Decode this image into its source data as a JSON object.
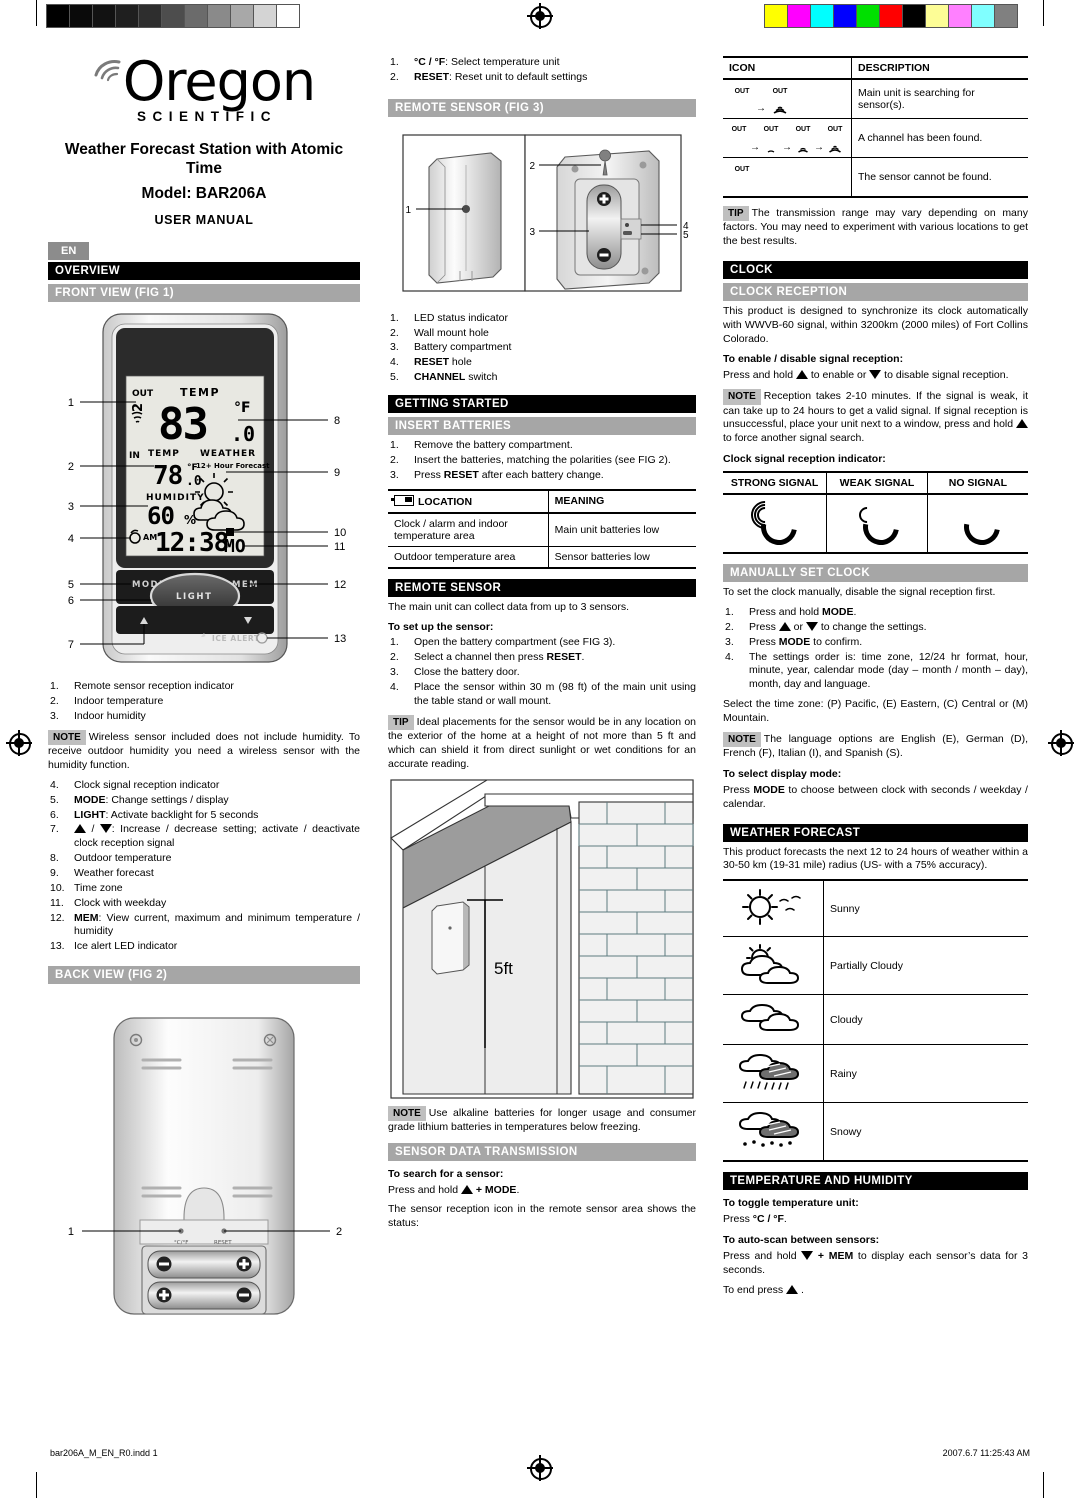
{
  "print_marks": {
    "grayscale_swatches": [
      "#000000",
      "#0a0a0a",
      "#121212",
      "#1f1f1f",
      "#2e2e2e",
      "#4d4d4d",
      "#6b6b6b",
      "#8a8a8a",
      "#a8a8a8",
      "#d4d4d4",
      "#ffffff"
    ],
    "color_swatches": [
      "#ffff00",
      "#ff00ff",
      "#00ffff",
      "#0000ff",
      "#00e000",
      "#ff0000",
      "#000000",
      "#fdfd96",
      "#ff80ff",
      "#80ffff",
      "#808080"
    ]
  },
  "title": {
    "brand": "Oregon",
    "brand_sub": "SCIENTIFIC",
    "product": "Weather Forecast Station with Atomic Time",
    "model": "Model: BAR206A",
    "doc_type": "USER MANUAL",
    "language_tab": "EN"
  },
  "left_column": {
    "overview_heading": "OVERVIEW",
    "front_view_heading": "FRONT VIEW (FIG 1)",
    "front_view_callouts_left": [
      "1",
      "2",
      "3",
      "4",
      "5",
      "6",
      "7"
    ],
    "front_view_callouts_right": [
      "8",
      "9",
      "10",
      "11",
      "12",
      "13"
    ],
    "lcd": {
      "out_label": "OUT",
      "channel": "2",
      "temp_label": "TEMP",
      "outdoor_temp": "83",
      "outdoor_unit": "°F",
      "outdoor_decimal": ".0",
      "in_label": "IN",
      "in_temp_label": "TEMP",
      "indoor_temp": "78",
      "indoor_unit": "°F",
      "indoor_decimal": ".0",
      "humidity_label": "HUMIDITY",
      "humidity": "60",
      "humidity_unit": "%",
      "weather_label": "WEATHER",
      "forecast_label": "12+ Hour Forecast",
      "am_label": "AM",
      "clock": "12:38",
      "weekday": "MO"
    },
    "buttons": {
      "mode": "MODE",
      "light": "LIGHT",
      "mem": "MEM",
      "ice_alert": "ICE ALERT"
    },
    "front_items": [
      {
        "n": "1.",
        "text": "Remote sensor reception indicator"
      },
      {
        "n": "2.",
        "text": "Indoor temperature"
      },
      {
        "n": "3.",
        "text": "Indoor humidity"
      }
    ],
    "note_humidity": {
      "tag": "NOTE",
      "text": "Wireless sensor included does not include humidity. To receive outdoor humidity you need a wireless sensor with the humidity function."
    },
    "front_items2": [
      {
        "n": "4.",
        "text": "Clock signal reception indicator"
      },
      {
        "n": "5.",
        "bold": "MODE",
        "text": ": Change settings / display"
      },
      {
        "n": "6.",
        "bold": "LIGHT",
        "text": ": Activate backlight for 5 seconds"
      },
      {
        "n": "7.",
        "text": ": Increase / decrease setting; activate / deactivate clock reception signal",
        "icons": true
      },
      {
        "n": "8.",
        "text": "Outdoor temperature"
      },
      {
        "n": "9.",
        "text": "Weather forecast"
      },
      {
        "n": "10.",
        "text": "Time zone"
      },
      {
        "n": "11.",
        "text": "Clock with weekday"
      },
      {
        "n": "12.",
        "bold": "MEM",
        "text": ": View current, maximum and minimum temperature / humidity"
      },
      {
        "n": "13.",
        "text": "Ice alert LED indicator"
      }
    ],
    "back_view_heading": "BACK VIEW (FIG 2)",
    "back_view_callouts": [
      "1",
      "2"
    ],
    "back_labels": {
      "cf": "°C/°F",
      "reset": "RESET"
    }
  },
  "mid_column": {
    "back_items": [
      {
        "n": "1.",
        "bold": "°C / °F",
        "text": ": Select temperature unit"
      },
      {
        "n": "2.",
        "bold": "RESET",
        "text": ": Reset unit to default settings"
      }
    ],
    "remote_sensor_fig_heading": "REMOTE SENSOR (FIG 3)",
    "remote_fig_callouts": [
      "1",
      "2",
      "3",
      "4",
      "5"
    ],
    "remote_items": [
      {
        "n": "1.",
        "text": "LED status indicator"
      },
      {
        "n": "2.",
        "text": "Wall mount hole"
      },
      {
        "n": "3.",
        "text": "Battery compartment"
      },
      {
        "n": "4.",
        "bold": "RESET",
        "text": " hole"
      },
      {
        "n": "5.",
        "bold": "CHANNEL",
        "text": " switch"
      }
    ],
    "getting_started_heading": "GETTING STARTED",
    "insert_batteries_heading": "INSERT BATTERIES",
    "battery_items": [
      {
        "n": "1.",
        "text": "Remove the battery compartment."
      },
      {
        "n": "2.",
        "text": "Insert the batteries, matching the polarities (see FIG 2)."
      },
      {
        "n": "3.",
        "bold": "RESET",
        "pre": "Press ",
        "text": " after each battery change."
      }
    ],
    "battery_table": {
      "headers": [
        "LOCATION",
        "MEANING"
      ],
      "rows": [
        [
          "Clock / alarm and indoor temperature area",
          "Main unit batteries low"
        ],
        [
          "Outdoor temperature area",
          "Sensor batteries low"
        ]
      ]
    },
    "remote_sensor_heading": "REMOTE SENSOR",
    "remote_intro": "The main unit can collect data from up to 3 sensors.",
    "setup_subhead": "To set up the sensor:",
    "setup_items": [
      {
        "n": "1.",
        "text": "Open the battery compartment (see FIG 3)."
      },
      {
        "n": "2.",
        "pre": "Select a channel then press ",
        "bold": "RESET",
        "text": "."
      },
      {
        "n": "3.",
        "text": "Close the battery door."
      },
      {
        "n": "4.",
        "text": "Place the sensor within 30 m (98 ft) of the main unit using the table stand or wall mount."
      }
    ],
    "tip_placement": {
      "tag": "TIP",
      "text": "Ideal placements for the sensor would be in any location on the exterior of the home at a height of not more than 5 ft and which can shield it from direct sunlight or wet conditions for an accurate reading."
    },
    "house_fig_label": "5ft",
    "note_alkaline": {
      "tag": "NOTE",
      "text": "Use alkaline batteries for longer usage and consumer grade lithium batteries in temperatures below freezing."
    },
    "sensor_data_heading": "SENSOR DATA TRANSMISSION",
    "search_subhead": "To search for a sensor:",
    "search_text_pre": "Press and hold ",
    "search_text_post": " + MODE",
    "search_text_end": ".",
    "status_text": "The sensor reception icon in the remote sensor area shows the status:"
  },
  "right_column": {
    "icon_table": {
      "headers": [
        "ICON",
        "DESCRIPTION"
      ],
      "rows": [
        {
          "icon_type": "searching",
          "description": "Main unit is searching for sensor(s)."
        },
        {
          "icon_type": "found",
          "description": "A channel has been found."
        },
        {
          "icon_type": "notfound",
          "description": "The sensor cannot be found."
        }
      ],
      "out_label": "OUT"
    },
    "tip_range": {
      "tag": "TIP",
      "text": "The transmission range may vary depending on many factors. You may need to experiment with various locations to get the best results."
    },
    "clock_heading": "CLOCK",
    "clock_reception_heading": "CLOCK RECEPTION",
    "clock_reception_text": "This product is designed to synchronize its clock automatically with WWVB-60 signal, within 3200km (2000 miles) of Fort Collins Colorado.",
    "enable_subhead": "To enable / disable signal reception:",
    "enable_pre": "Press and hold ",
    "enable_mid": " to enable or ",
    "enable_post": " to disable signal reception.",
    "note_reception": {
      "tag": "NOTE",
      "pre": "Reception takes 2-10 minutes. If the signal is weak, it can take up to 24 hours to get a valid signal. If signal reception is unsuccessful, place your unit next to a window, press and hold ",
      "post": " to force another signal search."
    },
    "clock_indicator_subhead": "Clock signal reception indicator:",
    "signal_table": {
      "headers": [
        "STRONG SIGNAL",
        "WEAK SIGNAL",
        "NO SIGNAL"
      ]
    },
    "manual_clock_heading": "MANUALLY SET CLOCK",
    "manual_clock_intro": "To set the clock manually, disable the signal reception first.",
    "manual_items": [
      {
        "n": "1.",
        "pre": "Press and hold ",
        "bold": "MODE",
        "text": "."
      },
      {
        "n": "2.",
        "pre": "Press ",
        "text": " to change the settings.",
        "icons": "updown"
      },
      {
        "n": "3.",
        "pre": "Press ",
        "bold": "MODE",
        "text": " to confirm."
      },
      {
        "n": "4.",
        "text": "The settings order is: time zone, 12/24 hr format, hour, minute, year, calendar mode (day – month / month – day), month, day and language."
      }
    ],
    "timezone_text": "Select the time zone: (P) Pacific, (E) Eastern, (C) Central or (M) Mountain.",
    "note_language": {
      "tag": "NOTE",
      "text": "The language options are English (E), German (D), French (F), Italian (I), and Spanish (S)."
    },
    "display_mode_subhead": "To select display mode:",
    "display_mode_pre": "Press ",
    "display_mode_bold": "MODE",
    "display_mode_post": " to choose between clock with seconds / weekday / calendar.",
    "weather_heading": "WEATHER FORECAST",
    "weather_intro": "This product forecasts the next 12 to 24 hours of weather within a 30-50 km (19-31 mile) radius (US- with a 75% accuracy).",
    "weather_rows": [
      {
        "icon": "sunny-icon",
        "label": "Sunny"
      },
      {
        "icon": "partially-cloudy-icon",
        "label": "Partially Cloudy"
      },
      {
        "icon": "cloudy-icon",
        "label": "Cloudy"
      },
      {
        "icon": "rainy-icon",
        "label": "Rainy"
      },
      {
        "icon": "snowy-icon",
        "label": "Snowy"
      }
    ],
    "temp_hum_heading": "TEMPERATURE AND HUMIDITY",
    "toggle_subhead": "To toggle temperature unit:",
    "toggle_pre": "Press ",
    "toggle_bold": "°C / °F",
    "toggle_post": ".",
    "autoscan_subhead": "To auto-scan between sensors:",
    "autoscan_pre": "Press and hold ",
    "autoscan_bold": " + MEM",
    "autoscan_post": " to display each sensor’s data for 3 seconds.",
    "autoscan_end_pre": "To end press ",
    "autoscan_end_post": " ."
  },
  "footer": {
    "filename": "bar206A_M_EN_R0.indd   1",
    "timestamp": "2007.6.7   11:25:43 AM"
  }
}
